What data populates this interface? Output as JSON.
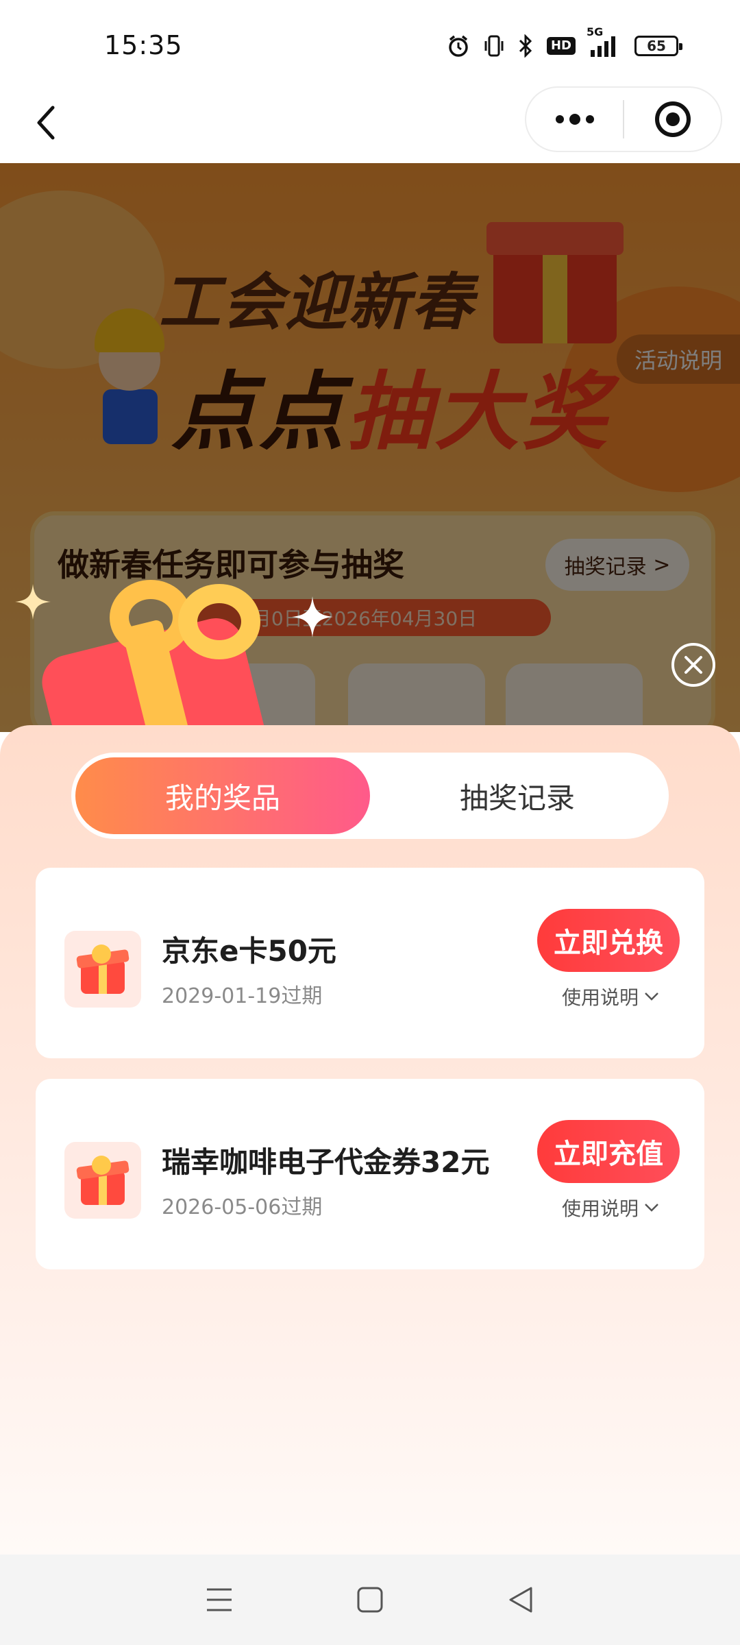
{
  "status_bar": {
    "time": "15:35",
    "hd_label": "HD",
    "signal_label": "5G",
    "battery_level": "65"
  },
  "nav": {
    "back_icon": "chevron-left-icon",
    "more_icon": "more-dots-icon",
    "close_icon": "target-circle-icon"
  },
  "banner": {
    "title_line1": "工会迎新春",
    "title_line2_dark": "点点",
    "title_line2_red": "抽大奖",
    "activity_rules": "活动说明",
    "task_title": "做新春任务即可参与抽奖",
    "draw_record": "抽奖记录",
    "date_range": "2月0日至2026年04月30日"
  },
  "sheet": {
    "tabs": [
      {
        "label": "我的奖品",
        "active": true
      },
      {
        "label": "抽奖记录",
        "active": false
      }
    ],
    "prizes": [
      {
        "name": "京东e卡50元",
        "expiry": "2029-01-19过期",
        "action": "立即兑换",
        "instructions": "使用说明"
      },
      {
        "name": "瑞幸咖啡电子代金券32元",
        "expiry": "2026-05-06过期",
        "action": "立即充值",
        "instructions": "使用说明"
      }
    ]
  },
  "colors": {
    "accent_gradient_start": "#ff8c4a",
    "accent_gradient_end": "#ff5a8a",
    "action_red": "#ff3b3b",
    "sheet_bg": "#ffdccb"
  }
}
